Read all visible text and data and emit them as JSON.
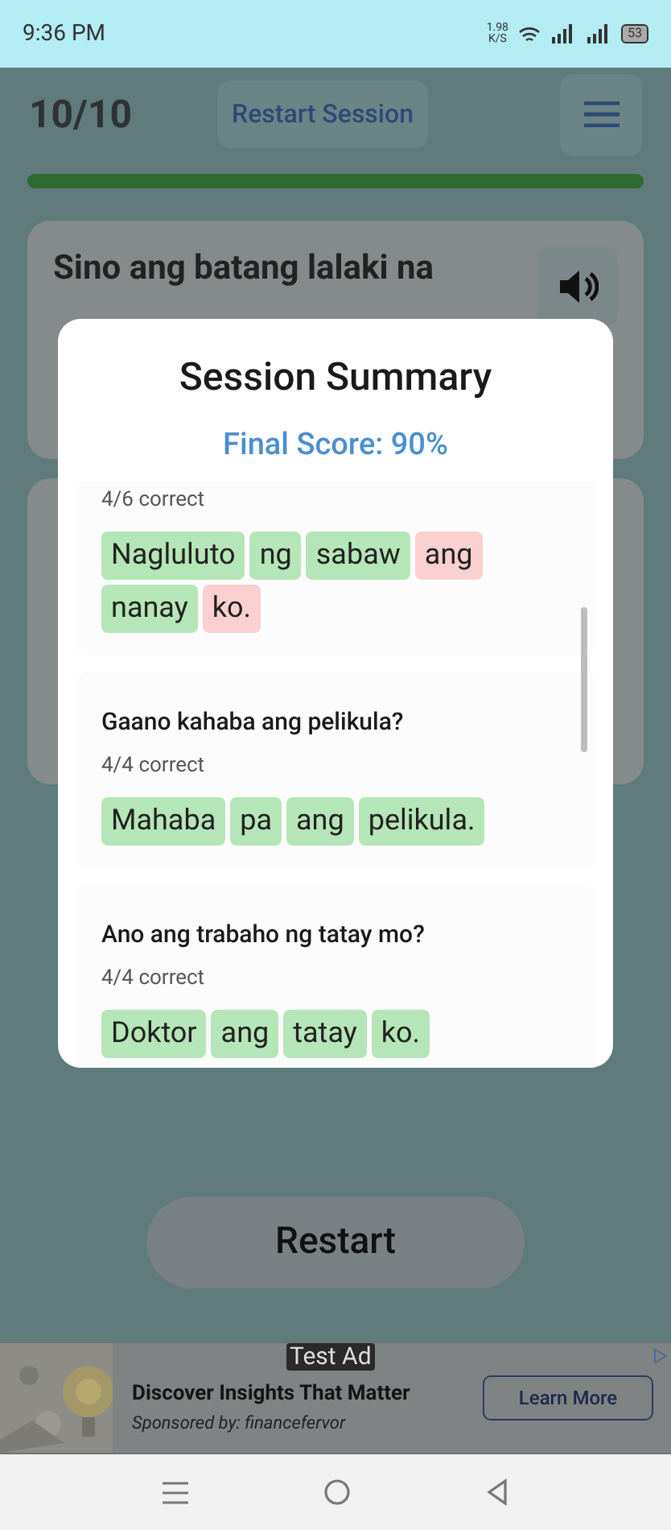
{
  "status_bar": {
    "time": "9:36 PM",
    "speed": "1.98",
    "speed_unit": "K/S",
    "battery": "53"
  },
  "header": {
    "progress_count": "10/10",
    "restart_session": "Restart Session",
    "progress": {
      "level": 1
    }
  },
  "question_card": {
    "text": "Sino ang batang lalaki na"
  },
  "dialog": {
    "title": "Session Summary",
    "final_score": "Final Score: 90%",
    "items": [
      {
        "result": "4/6 correct",
        "words": [
          {
            "text": "Nagluluto",
            "correct": true
          },
          {
            "text": "ng",
            "correct": true
          },
          {
            "text": "sabaw",
            "correct": true
          },
          {
            "text": "ang",
            "correct": false
          },
          {
            "text": "nanay",
            "correct": true
          },
          {
            "text": "ko.",
            "correct": false
          }
        ]
      },
      {
        "question": "Gaano kahaba ang pelikula?",
        "result": "4/4 correct",
        "words": [
          {
            "text": "Mahaba",
            "correct": true
          },
          {
            "text": "pa",
            "correct": true
          },
          {
            "text": "ang",
            "correct": true
          },
          {
            "text": "pelikula.",
            "correct": true
          }
        ]
      },
      {
        "question": "Ano ang trabaho ng tatay mo?",
        "result": "4/4 correct",
        "words": [
          {
            "text": "Doktor",
            "correct": true
          },
          {
            "text": "ang",
            "correct": true
          },
          {
            "text": "tatay",
            "correct": true
          },
          {
            "text": "ko.",
            "correct": true
          }
        ]
      }
    ]
  },
  "restart_button": "Restart",
  "ad": {
    "badge": "Test Ad",
    "headline": "Discover Insights That Matter",
    "sponsor": "Sponsored by: financefervor",
    "cta": "Learn More"
  }
}
